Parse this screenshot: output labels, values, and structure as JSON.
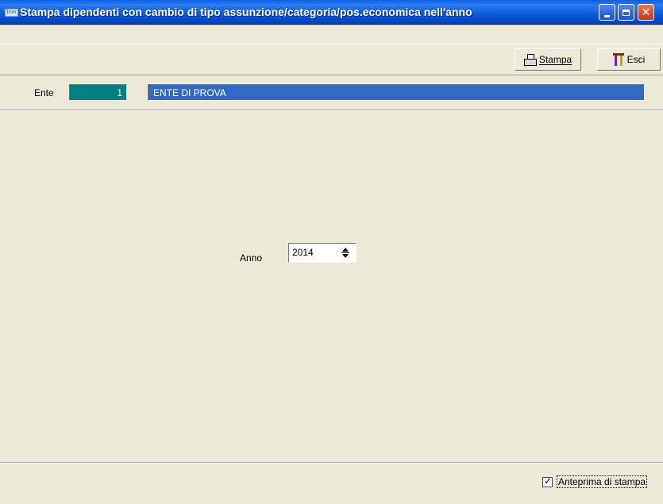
{
  "window": {
    "title": "Stampa dipendenti con cambio di tipo assunzione/categoria/pos.economica nell'anno",
    "app_icon_text": "tnm"
  },
  "toolbar": {
    "stampa_label": "Stampa",
    "esci_label": "Esci"
  },
  "ente": {
    "label": "Ente",
    "code": "1",
    "name": "ENTE DI PROVA"
  },
  "anno": {
    "label": "Anno",
    "value": "2014"
  },
  "footer": {
    "anteprima_label": "Anteprima di stampa",
    "anteprima_checked": true
  },
  "colors": {
    "titlebar": "#0a5ee6",
    "ente_code_bg": "#008080",
    "ente_name_bg": "#316ac5",
    "window_bg": "#ece9d8"
  }
}
